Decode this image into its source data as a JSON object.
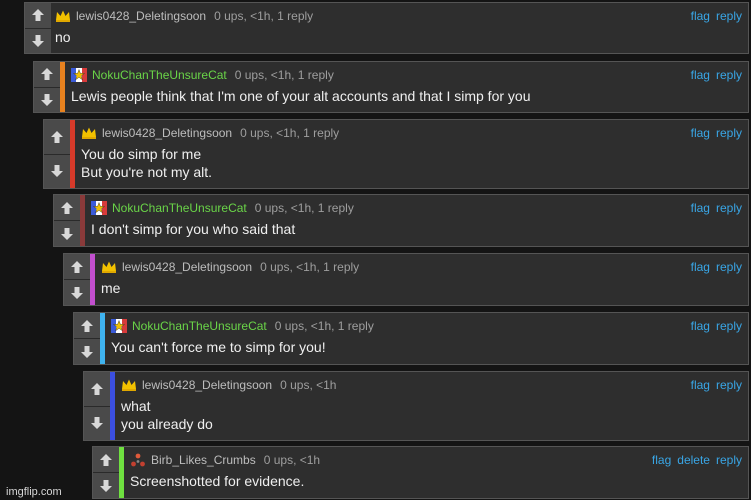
{
  "actions": {
    "flag": "flag",
    "reply": "reply",
    "delete": "delete"
  },
  "comments": [
    {
      "author": "lewis0428_Deletingsoon",
      "stats": "0 ups, <1h, 1 reply",
      "lines": [
        "no"
      ],
      "avatar": "crown-icon",
      "bar_color": ""
    },
    {
      "author": "NokuChanTheUnsureCat",
      "stats": "0 ups, <1h, 1 reply",
      "lines": [
        "Lewis people think that I'm one of your alt accounts and that I simp for you"
      ],
      "avatar": "star-flag-icon",
      "bar_color": "#e8821f"
    },
    {
      "author": "lewis0428_Deletingsoon",
      "stats": "0 ups, <1h, 1 reply",
      "lines": [
        "You do simp for me",
        "But you're not my alt."
      ],
      "avatar": "crown-icon",
      "bar_color": "#d63a2a"
    },
    {
      "author": "NokuChanTheUnsureCat",
      "stats": "0 ups, <1h, 1 reply",
      "lines": [
        "I don't simp for you who said that"
      ],
      "avatar": "star-flag-icon",
      "bar_color": "#8a3a3a"
    },
    {
      "author": "lewis0428_Deletingsoon",
      "stats": "0 ups, <1h, 1 reply",
      "lines": [
        "me"
      ],
      "avatar": "crown-icon",
      "bar_color": "#c24fcf"
    },
    {
      "author": "NokuChanTheUnsureCat",
      "stats": "0 ups, <1h, 1 reply",
      "lines": [
        "You can't force me to simp for you!"
      ],
      "avatar": "star-flag-icon",
      "bar_color": "#3fb4f0"
    },
    {
      "author": "lewis0428_Deletingsoon",
      "stats": "0 ups, <1h",
      "lines": [
        "what",
        "you already do"
      ],
      "avatar": "crown-icon",
      "bar_color": "#3b4fe0"
    },
    {
      "author": "Birb_Likes_Crumbs",
      "stats": "0 ups, <1h",
      "lines": [
        "Screenshotted for evidence."
      ],
      "avatar": "triangle-dots-icon",
      "bar_color": "#6fe040",
      "can_delete": true
    }
  ],
  "watermark": "imgflip.com"
}
